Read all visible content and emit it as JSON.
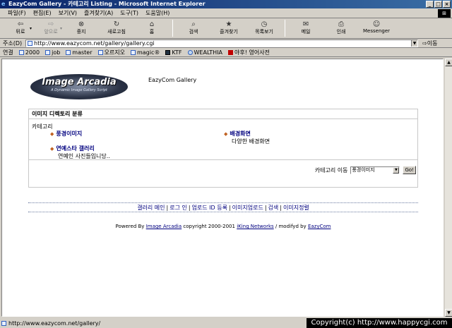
{
  "window": {
    "title": "EazyCom Gallery - 카테고리 Listing - Microsoft Internet Explorer",
    "controls": [
      "_",
      "□",
      "×"
    ]
  },
  "menubar": {
    "items": [
      "파일(F)",
      "편집(E)",
      "보기(V)",
      "즐겨찾기(A)",
      "도구(T)",
      "도움말(H)"
    ]
  },
  "toolbar": {
    "back": "뒤로",
    "forward": "앞으로",
    "stop": "중지",
    "refresh": "새로고침",
    "home": "홈",
    "search": "검색",
    "favorites": "즐겨찾기",
    "history": "목록보기",
    "mail": "메일",
    "print": "인쇄",
    "messenger": "Messenger"
  },
  "addressbar": {
    "label": "주소(D)",
    "url": "http://www.eazycom.net/gallery/gallery.cgi",
    "go": "이동"
  },
  "linksbar": {
    "label": "연결",
    "links": [
      "2000",
      "job",
      "master",
      "오르지오",
      "magic®",
      "KTF",
      "WEALTHIA",
      "야후! 영어사전"
    ]
  },
  "page": {
    "logo_title": "Image Arcadia",
    "logo_subtitle": "A Dynamic Image Gallery Script",
    "site_title": "EazyCom Gallery",
    "category_header": "이미지 디렉토리 분류",
    "category_label": "카테고리",
    "categories": [
      {
        "name": "풍경이미지",
        "desc": ""
      },
      {
        "name": "배경화면",
        "desc": "다양한 배경화면"
      },
      {
        "name": "연예스타 갤러리",
        "desc": "연예인 사진들입니당.."
      }
    ],
    "jump_label": "카테고리 이동",
    "jump_selected": "풍경이미지",
    "jump_button": "Go!",
    "nav_links": [
      "갤러리 메인",
      "로그 인",
      "업로드 ID 등록",
      "이미지업로드",
      "검색",
      "이미지정렬"
    ],
    "footer": {
      "powered_by": "Powered By",
      "script_link": "Image Arcadia",
      "copyright": "copyright 2000-2001",
      "author": "iKing Networks",
      "modified_by": "/ modifyd by",
      "modifier_link": "EazyCom"
    }
  },
  "statusbar": {
    "url": "http://www.eazycom.net/gallery/",
    "watermark": "Copyright(c) http://www.happycgi.com"
  }
}
